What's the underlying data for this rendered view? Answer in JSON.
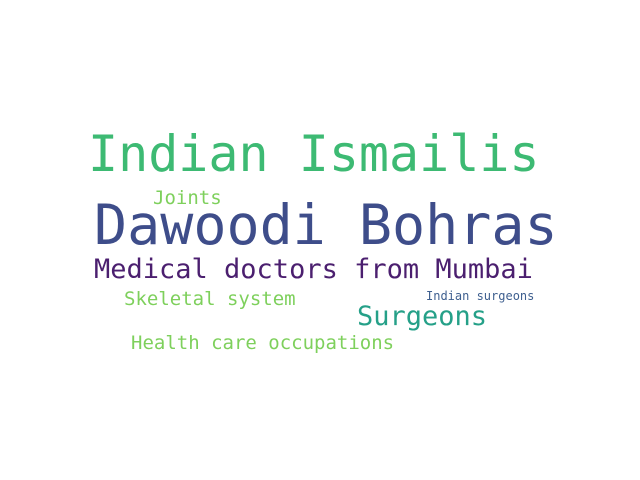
{
  "words": [
    {
      "id": "indian-ismailis",
      "text": "Indian Ismailis",
      "color": "#3dba73"
    },
    {
      "id": "dawoodi-bohras",
      "text": "Dawoodi Bohras",
      "color": "#3e4d8a"
    },
    {
      "id": "medical-doctors",
      "text": "Medical doctors from Mumbai",
      "color": "#4b1f6f"
    },
    {
      "id": "joints",
      "text": "Joints",
      "color": "#7ed05c"
    },
    {
      "id": "skeletal-system",
      "text": "Skeletal system",
      "color": "#7ed05c"
    },
    {
      "id": "surgeons",
      "text": "Surgeons",
      "color": "#25a088"
    },
    {
      "id": "indian-surgeons",
      "text": "Indian surgeons",
      "color": "#3e5f8f"
    },
    {
      "id": "health-care",
      "text": "Health care occupations",
      "color": "#7ed05c"
    }
  ]
}
